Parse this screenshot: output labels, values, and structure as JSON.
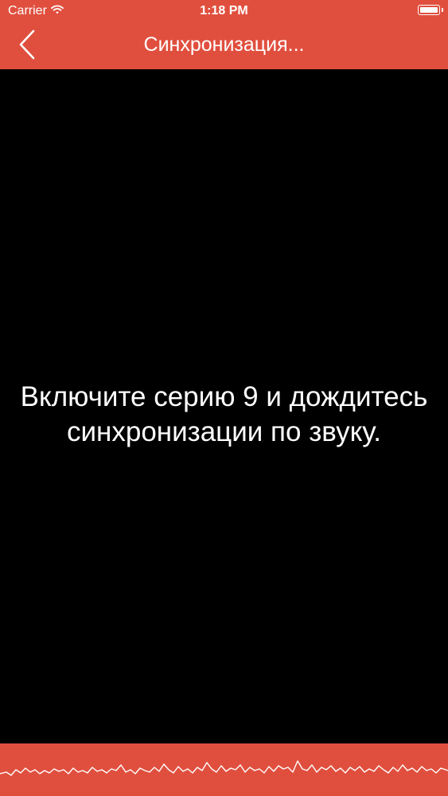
{
  "status_bar": {
    "carrier": "Carrier",
    "time": "1:18 PM",
    "wifi_icon": "wifi-icon",
    "battery_icon": "battery-icon"
  },
  "nav": {
    "title": "Синхронизация...",
    "back_icon": "chevron-left-icon"
  },
  "main": {
    "message": "Включите серию 9 и дождитесь синхронизации по звуку."
  },
  "colors": {
    "accent": "#E04F3E",
    "background": "#000000",
    "text": "#FFFFFF"
  },
  "audio_waveform": {
    "icon": "audio-waveform"
  }
}
